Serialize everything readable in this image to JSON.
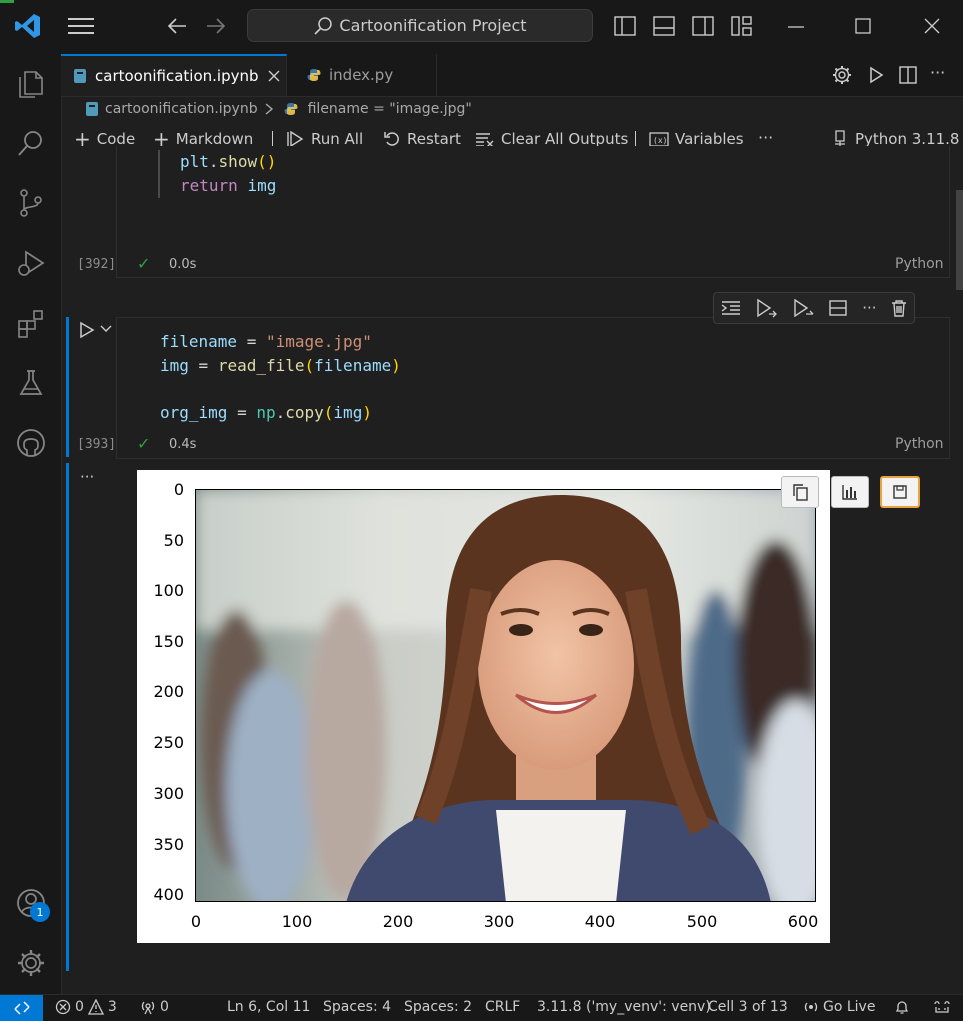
{
  "titlebar": {
    "search_text": "Cartoonification Project"
  },
  "tabs": [
    {
      "label": "cartoonification.ipynb",
      "active": true
    },
    {
      "label": "index.py",
      "active": false
    }
  ],
  "breadcrumb": {
    "file": "cartoonification.ipynb",
    "symbol": "filename = \"image.jpg\""
  },
  "toolbar": {
    "code": "Code",
    "markdown": "Markdown",
    "run_all": "Run All",
    "restart": "Restart",
    "clear_outputs": "Clear All Outputs",
    "variables": "Variables",
    "more": "···",
    "kernel": "Python 3.11.8"
  },
  "cell_392": {
    "line1": {
      "obj": "plt",
      "dot": ".",
      "fn": "show",
      "parens": "()"
    },
    "line2": {
      "kw": "return",
      "var": "img"
    },
    "exec_count": "[392]",
    "time": "0.0s",
    "lang": "Python"
  },
  "cell_393": {
    "line1": {
      "var": "filename",
      "op": " = ",
      "str": "\"image.jpg\""
    },
    "line2": {
      "var": "img",
      "op": " = ",
      "fn": "read_file",
      "p1": "(",
      "arg": "filename",
      "p2": ")"
    },
    "line3": {
      "var": "org_img",
      "op": " = ",
      "mod": "np",
      "dot": ".",
      "fn": "copy",
      "p1": "(",
      "arg": "img",
      "p2": ")"
    },
    "exec_count": "[393]",
    "time": "0.4s",
    "lang": "Python"
  },
  "output": {
    "more": "···",
    "y_ticks": [
      "0",
      "50",
      "100",
      "150",
      "200",
      "250",
      "300",
      "350",
      "400"
    ],
    "x_ticks": [
      "0",
      "100",
      "200",
      "300",
      "400",
      "500",
      "600"
    ]
  },
  "statusbar": {
    "errors": "0",
    "warnings": "3",
    "ports": "0",
    "cursor": "Ln 6, Col 11",
    "spaces1": "Spaces: 4",
    "spaces2": "Spaces: 2",
    "eol": "CRLF",
    "interpreter": "3.11.8 ('my_venv': venv)",
    "cell": "Cell 3 of 13",
    "golive": "Go Live"
  },
  "accounts_badge": "1",
  "colors": {
    "accent": "#0078d4",
    "success": "#2ea043",
    "editor_bg": "#1f1f1f",
    "chrome_bg": "#181818"
  }
}
